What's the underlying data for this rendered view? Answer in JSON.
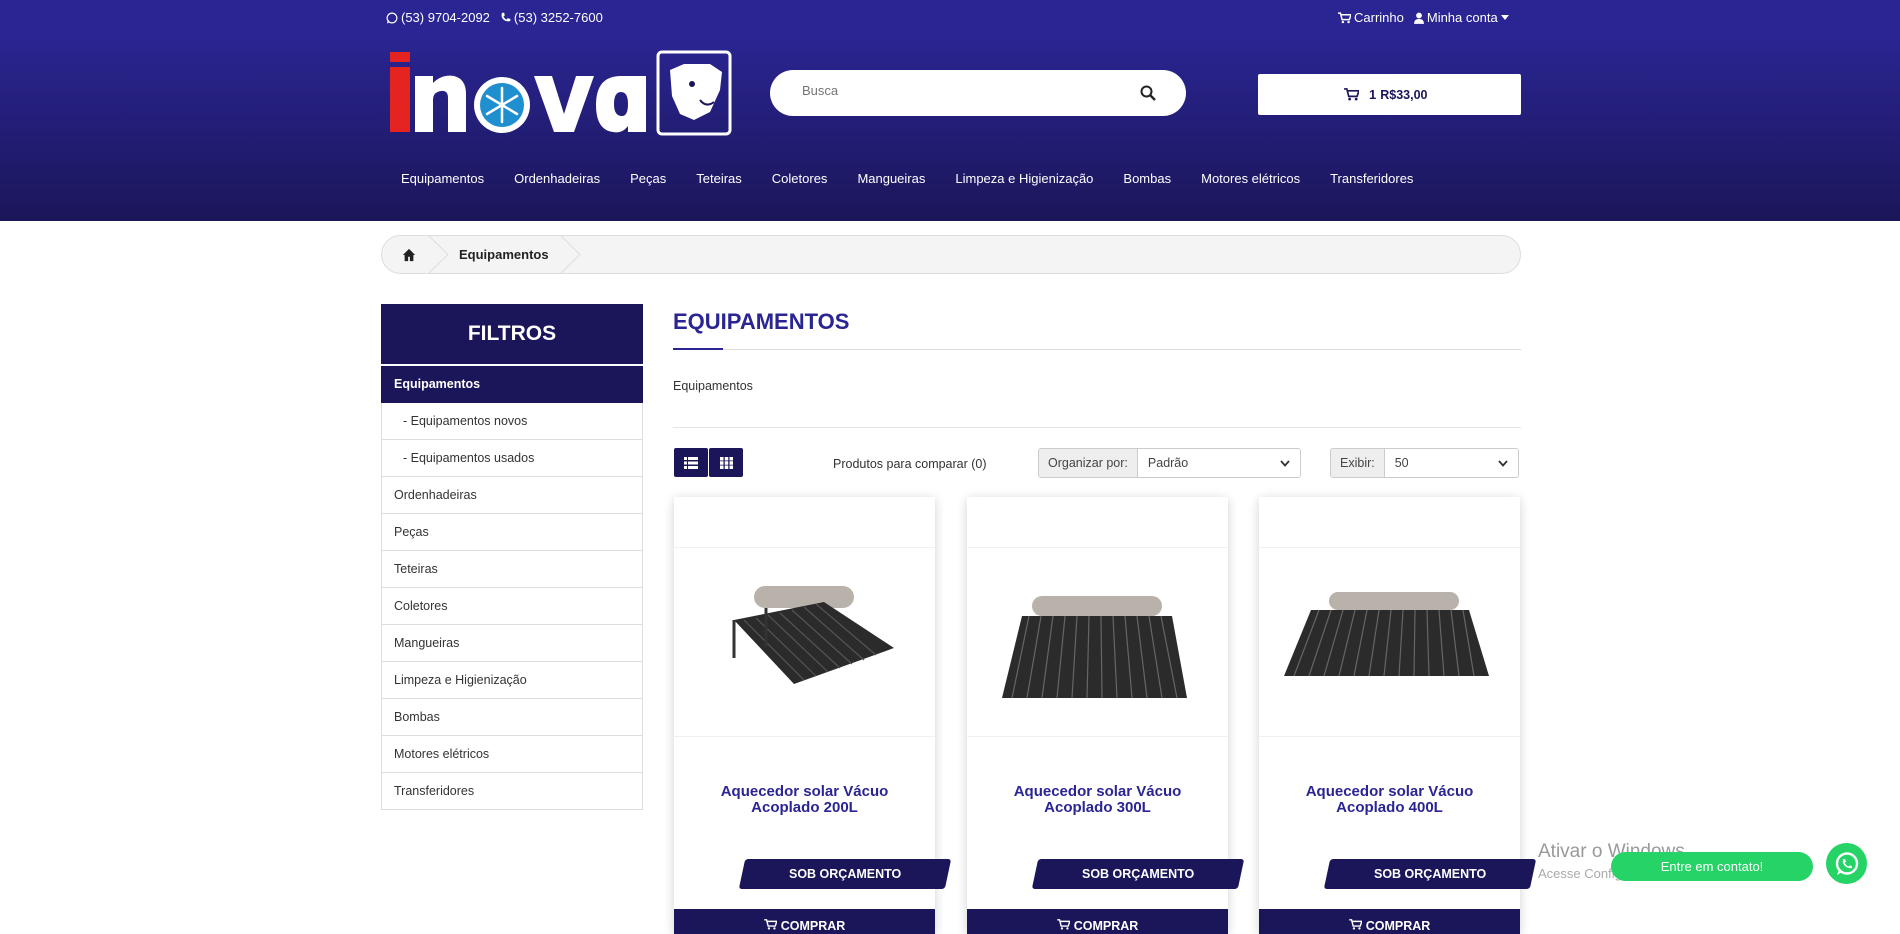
{
  "topbar": {
    "whatsapp_phone": "(53) 9704-2092",
    "phone": "(53) 3252-7600",
    "cart_label": "Carrinho",
    "account_label": "Minha conta"
  },
  "header": {
    "logo_text": "inova",
    "search_placeholder": "Busca",
    "cart_count": "1",
    "cart_total": "R$33,00"
  },
  "nav": [
    "Equipamentos",
    "Ordenhadeiras",
    "Peças",
    "Teteiras",
    "Coletores",
    "Mangueiras",
    "Limpeza e Higienização",
    "Bombas",
    "Motores elétricos",
    "Transferidores"
  ],
  "breadcrumb": {
    "current": "Equipamentos"
  },
  "filters": {
    "title": "FILTROS",
    "items": [
      {
        "label": "Equipamentos",
        "active": true
      },
      {
        "label": "- Equipamentos novos",
        "sub": true
      },
      {
        "label": "- Equipamentos usados",
        "sub": true
      },
      {
        "label": "Ordenhadeiras"
      },
      {
        "label": "Peças"
      },
      {
        "label": "Teteiras"
      },
      {
        "label": "Coletores"
      },
      {
        "label": "Mangueiras"
      },
      {
        "label": "Limpeza e Higienização"
      },
      {
        "label": "Bombas"
      },
      {
        "label": "Motores elétricos"
      },
      {
        "label": "Transferidores"
      }
    ]
  },
  "main": {
    "title": "EQUIPAMENTOS",
    "description": "Equipamentos",
    "compare_label": "Produtos para comparar (0)",
    "sort_label": "Organizar por:",
    "sort_value": "Padrão",
    "show_label": "Exibir:",
    "show_value": "50"
  },
  "products": [
    {
      "name": "Aquecedor solar Vácuo Acoplado 200L",
      "badge": "SOB ORÇAMENTO",
      "buy": "COMPRAR"
    },
    {
      "name": "Aquecedor solar Vácuo Acoplado 300L",
      "badge": "SOB ORÇAMENTO",
      "buy": "COMPRAR"
    },
    {
      "name": "Aquecedor solar Vácuo Acoplado 400L",
      "badge": "SOB ORÇAMENTO",
      "buy": "COMPRAR"
    }
  ],
  "overlay": {
    "windows_title": "Ativar o Windows",
    "windows_sub": "Acesse Configurações para ativar o Windows.",
    "whatsapp_label": "Entre em contato!"
  },
  "colors": {
    "brand": "#2a2592",
    "brand_dark": "#1b1659",
    "whatsapp": "#25d366"
  }
}
